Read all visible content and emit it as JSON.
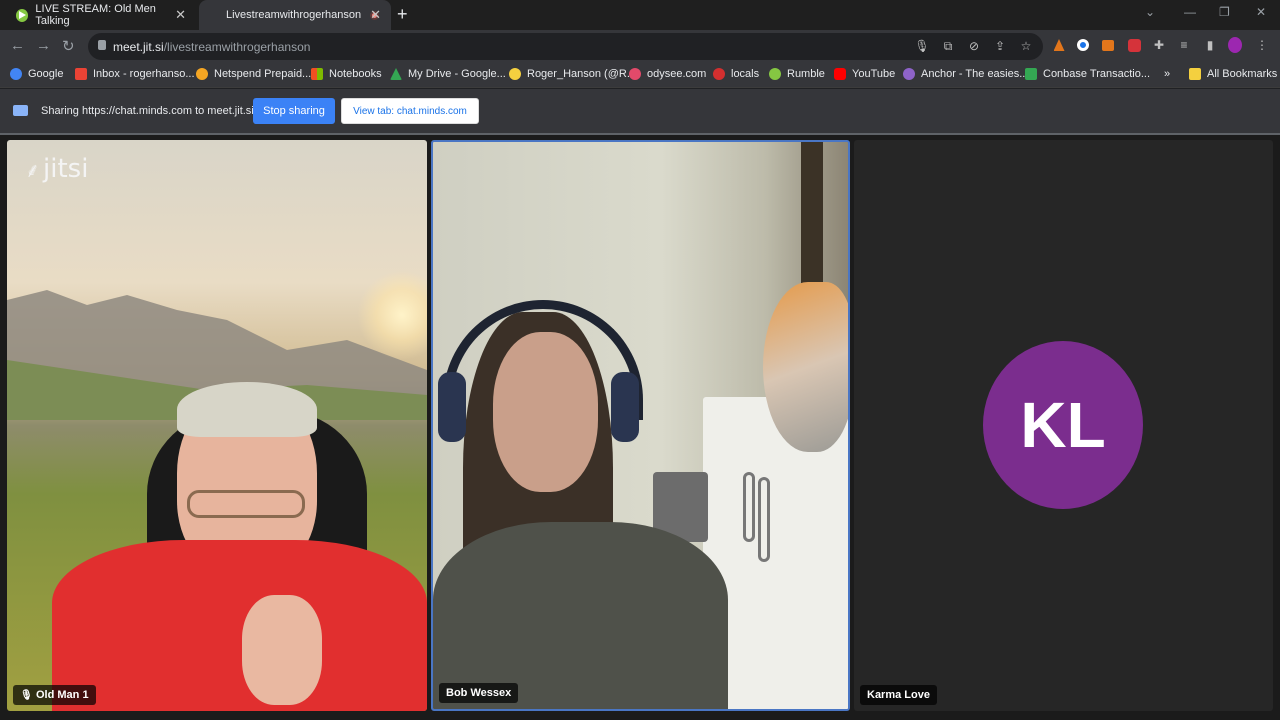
{
  "tabs": [
    {
      "title": "LIVE STREAM: Old Men Talking"
    },
    {
      "title": "Livestreamwithrogerhanson",
      "recording": true
    }
  ],
  "omnibox": {
    "domain": "meet.jit.si",
    "path": "/livestreamwithrogerhanson"
  },
  "bookmarks": [
    {
      "label": "Google",
      "color": "#4285f4"
    },
    {
      "label": "Inbox - rogerhanso...",
      "color": "#ea4335"
    },
    {
      "label": "Netspend Prepaid...",
      "color": "#f5a623"
    },
    {
      "label": "Notebooks",
      "color": "#f25022"
    },
    {
      "label": "My Drive - Google...",
      "color": "#34a853"
    },
    {
      "label": "Roger_Hanson (@R...",
      "color": "#f4d03f"
    },
    {
      "label": "odysee.com",
      "color": "#e24a6a"
    },
    {
      "label": "locals",
      "color": "#d32f2f"
    },
    {
      "label": "Rumble",
      "color": "#85c742"
    },
    {
      "label": "YouTube",
      "color": "#ff0000"
    },
    {
      "label": "Anchor - The easies...",
      "color": "#8e63c9"
    },
    {
      "label": "Conbase Transactio...",
      "color": "#34a853"
    }
  ],
  "bookmarks_more": "»",
  "all_bookmarks": "All Bookmarks",
  "sharebar": {
    "text": "Sharing https://chat.minds.com to meet.jit.si",
    "stop_label": "Stop sharing",
    "view_label": "View tab: chat.minds.com"
  },
  "participants": [
    {
      "name": "Old Man 1",
      "muted": true
    },
    {
      "name": "Bob Wessex",
      "muted": false,
      "active_speaker": true
    },
    {
      "name": "Karma Love",
      "muted": false,
      "initials": "KL",
      "avatar_color": "#7b2d8e"
    }
  ],
  "logo": {
    "text": "jitsi"
  }
}
